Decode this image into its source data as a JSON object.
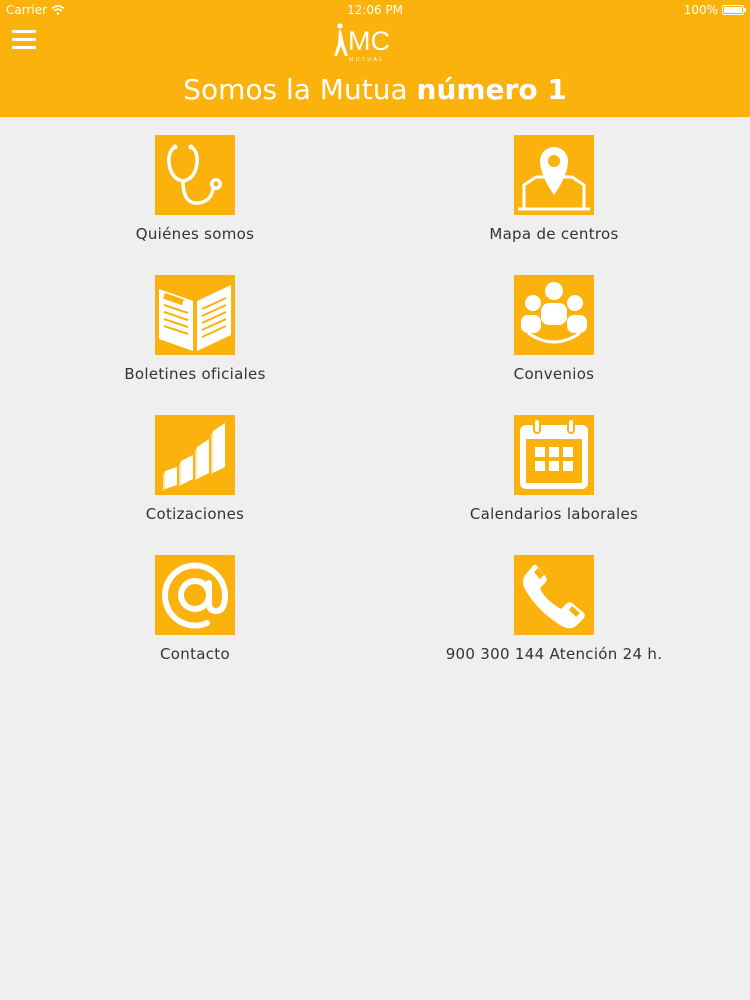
{
  "status_bar": {
    "carrier": "Carrier",
    "time": "12:06 PM",
    "battery": "100%"
  },
  "header": {
    "logo_text": "MC",
    "logo_subtext": "MUTUAL",
    "headline_regular": "Somos la Mutua",
    "headline_bold": "número 1"
  },
  "menu": {
    "items": [
      {
        "label": "Quiénes somos",
        "icon": "stethoscope-icon"
      },
      {
        "label": "Mapa de centros",
        "icon": "map-pin-icon"
      },
      {
        "label": "Boletines oficiales",
        "icon": "open-book-icon"
      },
      {
        "label": "Convenios",
        "icon": "group-icon"
      },
      {
        "label": "Cotizaciones",
        "icon": "bar-chart-icon"
      },
      {
        "label": "Calendarios laborales",
        "icon": "calendar-icon"
      },
      {
        "label": "Contacto",
        "icon": "at-sign-icon"
      },
      {
        "label": "900 300 144 Atención 24 h.",
        "icon": "phone-icon"
      }
    ]
  },
  "colors": {
    "accent": "#fbb20c",
    "background": "#efefef",
    "text": "#333333"
  }
}
